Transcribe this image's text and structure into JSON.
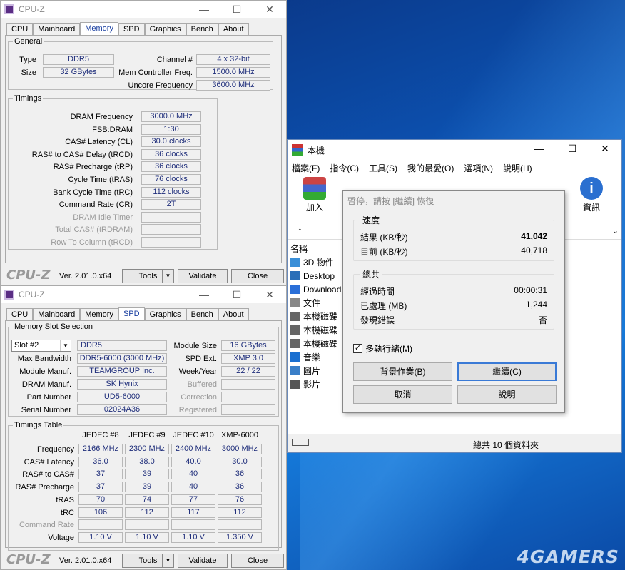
{
  "cpuz_top": {
    "title": "CPU-Z",
    "tabs": [
      "CPU",
      "Mainboard",
      "Memory",
      "SPD",
      "Graphics",
      "Bench",
      "About"
    ],
    "active_tab": "Memory",
    "general": {
      "legend": "General",
      "type_label": "Type",
      "type": "DDR5",
      "size_label": "Size",
      "size": "32 GBytes",
      "channel_label": "Channel #",
      "channel": "4 x 32-bit",
      "mc_label": "Mem Controller Freq.",
      "mc": "1500.0 MHz",
      "uncore_label": "Uncore Frequency",
      "uncore": "3600.0 MHz"
    },
    "timings": {
      "legend": "Timings",
      "rows": [
        {
          "label": "DRAM Frequency",
          "value": "3000.0 MHz"
        },
        {
          "label": "FSB:DRAM",
          "value": "1:30"
        },
        {
          "label": "CAS# Latency (CL)",
          "value": "30.0 clocks"
        },
        {
          "label": "RAS# to CAS# Delay (tRCD)",
          "value": "36 clocks"
        },
        {
          "label": "RAS# Precharge (tRP)",
          "value": "36 clocks"
        },
        {
          "label": "Cycle Time (tRAS)",
          "value": "76 clocks"
        },
        {
          "label": "Bank Cycle Time (tRC)",
          "value": "112 clocks"
        },
        {
          "label": "Command Rate (CR)",
          "value": "2T"
        },
        {
          "label": "DRAM Idle Timer",
          "value": ""
        },
        {
          "label": "Total CAS# (tRDRAM)",
          "value": ""
        },
        {
          "label": "Row To Column (tRCD)",
          "value": ""
        }
      ]
    },
    "footer": {
      "logo": "CPU-Z",
      "version": "Ver. 2.01.0.x64",
      "tools": "Tools",
      "validate": "Validate",
      "close": "Close"
    }
  },
  "cpuz_bottom": {
    "title": "CPU-Z",
    "tabs": [
      "CPU",
      "Mainboard",
      "Memory",
      "SPD",
      "Graphics",
      "Bench",
      "About"
    ],
    "active_tab": "SPD",
    "slot": {
      "legend": "Memory Slot Selection",
      "slot_value": "Slot #2",
      "type": "DDR5",
      "module_size_label": "Module Size",
      "module_size": "16 GBytes",
      "max_bw_label": "Max Bandwidth",
      "max_bw": "DDR5-6000 (3000 MHz)",
      "spd_ext_label": "SPD Ext.",
      "spd_ext": "XMP 3.0",
      "module_manuf_label": "Module Manuf.",
      "module_manuf": "TEAMGROUP Inc.",
      "week_year_label": "Week/Year",
      "week_year": "22 / 22",
      "dram_manuf_label": "DRAM Manuf.",
      "dram_manuf": "SK Hynix",
      "buffered_label": "Buffered",
      "part_label": "Part Number",
      "part": "UD5-6000",
      "correction_label": "Correction",
      "serial_label": "Serial Number",
      "serial": "02024A36",
      "registered_label": "Registered"
    },
    "timings_table": {
      "legend": "Timings Table",
      "headers": [
        "JEDEC #8",
        "JEDEC #9",
        "JEDEC #10",
        "XMP-6000"
      ],
      "rows": [
        {
          "label": "Frequency",
          "values": [
            "2166 MHz",
            "2300 MHz",
            "2400 MHz",
            "3000 MHz"
          ]
        },
        {
          "label": "CAS# Latency",
          "values": [
            "36.0",
            "38.0",
            "40.0",
            "30.0"
          ]
        },
        {
          "label": "RAS# to CAS#",
          "values": [
            "37",
            "39",
            "40",
            "36"
          ]
        },
        {
          "label": "RAS# Precharge",
          "values": [
            "37",
            "39",
            "40",
            "36"
          ]
        },
        {
          "label": "tRAS",
          "values": [
            "70",
            "74",
            "77",
            "76"
          ]
        },
        {
          "label": "tRC",
          "values": [
            "106",
            "112",
            "117",
            "112"
          ]
        },
        {
          "label": "Command Rate",
          "values": [
            "",
            "",
            "",
            ""
          ]
        },
        {
          "label": "Voltage",
          "values": [
            "1.10 V",
            "1.10 V",
            "1.10 V",
            "1.350 V"
          ]
        }
      ]
    },
    "footer": {
      "logo": "CPU-Z",
      "version": "Ver. 2.01.0.x64",
      "tools": "Tools",
      "validate": "Validate",
      "close": "Close"
    }
  },
  "rar": {
    "title": "本機",
    "menu": [
      "檔案(F)",
      "指令(C)",
      "工具(S)",
      "我的最愛(O)",
      "選項(N)",
      "說明(H)"
    ],
    "tool_add": "加入",
    "tool_info": "資訊",
    "column_name": "名稱",
    "items": [
      "3D 物件",
      "Desktop",
      "Download",
      "文件",
      "本機磁碟",
      "本機磁碟",
      "本機磁碟",
      "音樂",
      "圖片",
      "影片"
    ],
    "status": "總共 10 個資料夾"
  },
  "dialog": {
    "title": "暫停，請按 [繼續] 恢復",
    "speed_legend": "速度",
    "result_label": "結果 (KB/秒)",
    "result": "41,042",
    "current_label": "目前 (KB/秒)",
    "current": "40,718",
    "total_legend": "總共",
    "elapsed_label": "經過時間",
    "elapsed": "00:00:31",
    "processed_label": "已處理 (MB)",
    "processed": "1,244",
    "errors_label": "發現錯誤",
    "errors": "否",
    "multithread_label": "多執行緒(M)",
    "btn_background": "背景作業(B)",
    "btn_continue": "繼續(C)",
    "btn_cancel": "取消",
    "btn_help": "說明"
  },
  "watermark": "4GAMERS"
}
